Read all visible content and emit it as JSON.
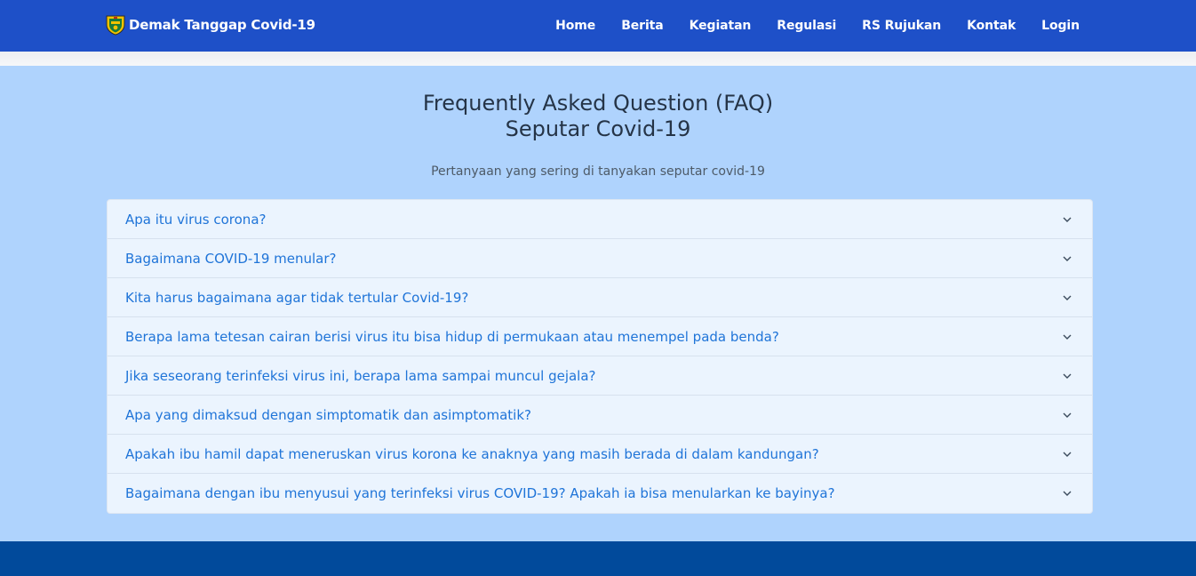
{
  "navbar": {
    "brand": "Demak Tanggap Covid-19",
    "brand_icon": "coat-of-arms-logo",
    "links": [
      "Home",
      "Berita",
      "Kegiatan",
      "Regulasi",
      "RS Rujukan",
      "Kontak",
      "Login"
    ]
  },
  "faq": {
    "title_line1": "Frequently Asked Question (FAQ)",
    "title_line2": "Seputar Covid-19",
    "subtitle": "Pertanyaan yang sering di tanyakan seputar covid-19",
    "items": [
      "Apa itu virus corona?",
      "Bagaimana COVID-19 menular?",
      "Kita harus bagaimana agar tidak tertular Covid-19?",
      "Berapa lama tetesan cairan berisi virus itu bisa hidup di permukaan atau menempel pada benda?",
      "Jika seseorang terinfeksi virus ini, berapa lama sampai muncul gejala?",
      "Apa yang dimaksud dengan simptomatik dan asimptomatik?",
      "Apakah ibu hamil dapat meneruskan virus korona ke anaknya yang masih berada di dalam kandungan?",
      "Bagaimana dengan ibu menyusui yang terinfeksi virus COVID-19? Apakah ia bisa menularkan ke bayinya?"
    ],
    "item_icon": "chevron-down-icon"
  },
  "colors": {
    "navbar_bg": "#1e50c8",
    "section_bg": "#afd3fd",
    "accordion_bg": "#ebf4fe",
    "question_text": "#1f74d8",
    "footer_bg": "#014a9b"
  }
}
